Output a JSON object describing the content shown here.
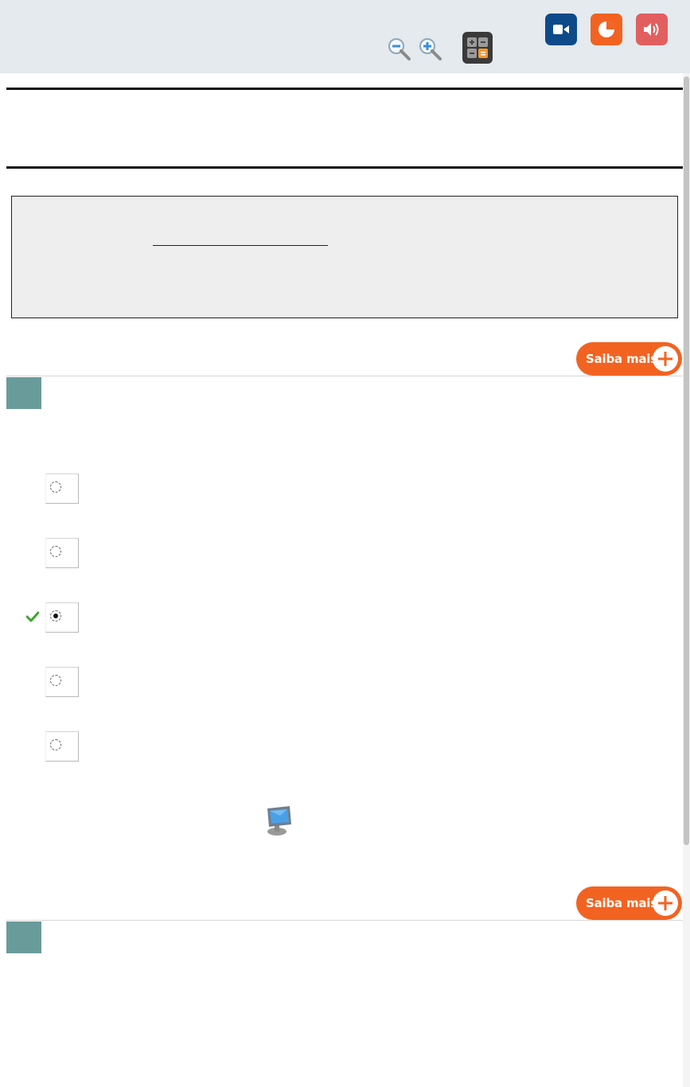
{
  "toolbar": {
    "icons": [
      "zoom-out-icon",
      "zoom-in-icon",
      "calculator-icon",
      "video-icon",
      "pie-chart-icon",
      "audio-icon"
    ],
    "colors": {
      "background": "#e4eaee",
      "video": "#0e4a8a",
      "pie": "#f26322",
      "audio": "#e25f5f"
    }
  },
  "saiba_mais_1": {
    "label": "Saiba mais"
  },
  "saiba_mais_2": {
    "label": "Saiba mais"
  },
  "question": {
    "options": [
      {
        "selected": false,
        "correct": false
      },
      {
        "selected": false,
        "correct": false
      },
      {
        "selected": true,
        "correct": true
      },
      {
        "selected": false,
        "correct": false
      },
      {
        "selected": false,
        "correct": false
      }
    ],
    "accent": "#6a9b9b"
  }
}
